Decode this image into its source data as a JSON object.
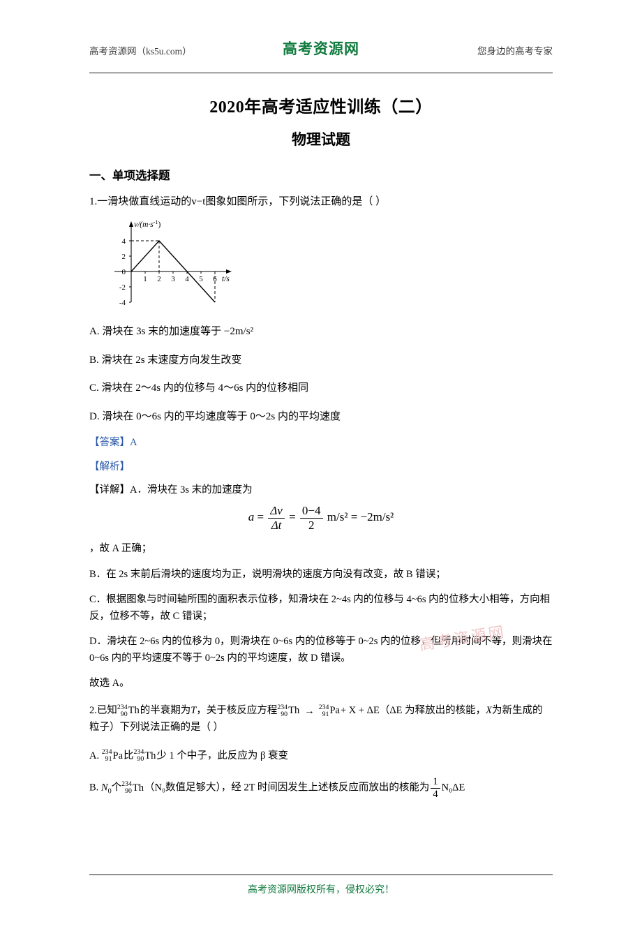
{
  "header": {
    "left": "高考资源网（ks5u.com）",
    "center": "高考资源网",
    "right": "您身边的高考专家"
  },
  "title": "2020年高考适应性训练（二）",
  "subtitle": "物理试题",
  "section_heading": "一、单项选择题",
  "q1": {
    "stem": "1.一滑块做直线运动的v−t图象如图所示，下列说法正确的是（          ）",
    "options": [
      "A. 滑块在 3s 末的加速度等于 −2m/s²",
      "B. 滑块在 2s 末速度方向发生改变",
      "C. 滑块在 2～4s 内的位移与 4～6s 内的位移相同",
      "D. 滑块在 0～6s 内的平均速度等于 0～2s 内的平均速度"
    ],
    "answer_label": "【答案】",
    "answer_value": "A",
    "analysis_label": "【解析】",
    "detail_lead": "【详解】A．滑块在 3s 末的加速度为",
    "formula": {
      "a": "a",
      "eq1": "=",
      "num1": "Δv",
      "den1": "Δt",
      "eq2": "=",
      "num2": "0−4",
      "den2": "2",
      "unit": "m/s²",
      "eq3": "=",
      "result": "−2m/s²"
    },
    "after_formula": "，故 A 正确；",
    "explain_b": "B．在 2s 末前后滑块的速度均为正，说明滑块的速度方向没有改变，故 B 错误；",
    "explain_c": "C．根据图象与时间轴所围的面积表示位移，知滑块在 2~4s 内的位移与 4~6s 内的位移大小相等，方向相反，位移不等，故 C 错误；",
    "explain_d": "D．滑块在 2~6s 内的位移为 0，则滑块在 0~6s 内的位移等于 0~2s 内的位移，但所用时间不等，则滑块在 0~6s 内的平均速度不等于 0~2s 内的平均速度，故 D 错误。",
    "conclusion": "故选 A。"
  },
  "chart_data": {
    "type": "line",
    "title": "",
    "ylabel": "v/(m·s⁻¹)",
    "xlabel": "t/s",
    "x_ticks": [
      1,
      2,
      3,
      4,
      5,
      6
    ],
    "y_ticks": [
      -4,
      -2,
      0,
      2,
      4
    ],
    "xlim": [
      0,
      6.8
    ],
    "ylim": [
      -4.6,
      5.2
    ],
    "grid": false,
    "dashed_guides": [
      {
        "from": [
          0,
          4
        ],
        "to": [
          2,
          4
        ]
      },
      {
        "from": [
          2,
          4
        ],
        "to": [
          2,
          0
        ]
      },
      {
        "from": [
          6,
          -4
        ],
        "to": [
          6,
          0
        ]
      }
    ],
    "series": [
      {
        "name": "v-t",
        "x": [
          0,
          2,
          6
        ],
        "y": [
          0,
          4,
          -4
        ]
      }
    ]
  },
  "q2": {
    "stem_part1": "2.已知",
    "nuclide_th": {
      "top": "234",
      "bottom": "90",
      "sym": "Th"
    },
    "stem_part2": "的半衰期为",
    "italic_T": "T",
    "stem_part3": "，关于核反应方程",
    "eq_left": {
      "top": "234",
      "bottom": "90",
      "sym": "Th"
    },
    "arrow": "→",
    "eq_right": {
      "top": "234",
      "bottom": "91",
      "sym": "Pa"
    },
    "eq_tail": "+ X + ΔE",
    "stem_part4": "（ΔE 为释放出的核能，",
    "italic_X": "X",
    "stem_part5": "为新生成的粒子）下列说法正确的是（         ）",
    "optA_pre": "A.",
    "optA_n1": {
      "top": "234",
      "bottom": "91",
      "sym": "Pa"
    },
    "optA_mid": "比",
    "optA_n2": {
      "top": "234",
      "bottom": "90",
      "sym": "Th"
    },
    "optA_post": "少 1 个中子，此反应为 β 衰变",
    "optB_pre": "B.",
    "optB_n0": "N",
    "optB_n0sub": "0",
    "optB_mid1": "个",
    "optB_n1": {
      "top": "234",
      "bottom": "90",
      "sym": "Th"
    },
    "optB_mid2": "（N₀数值足够大），经 2T 时间因发生上述核反应而放出的核能为",
    "optB_frac_num": "1",
    "optB_frac_den": "4",
    "optB_tail": "N₀ΔE"
  },
  "watermark": "高考资源网",
  "footer": "高考资源网版权所有，侵权必究！"
}
